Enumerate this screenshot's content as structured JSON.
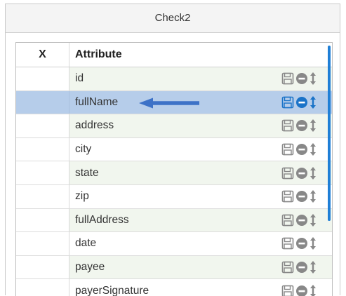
{
  "panel": {
    "title": "Check2"
  },
  "table": {
    "headers": {
      "x": "X",
      "attribute": "Attribute"
    },
    "rows": [
      {
        "label": "id",
        "selected": false
      },
      {
        "label": "fullName",
        "selected": true
      },
      {
        "label": "address",
        "selected": false
      },
      {
        "label": "city",
        "selected": false
      },
      {
        "label": "state",
        "selected": false
      },
      {
        "label": "zip",
        "selected": false
      },
      {
        "label": "fullAddress",
        "selected": false
      },
      {
        "label": "date",
        "selected": false
      },
      {
        "label": "payee",
        "selected": false
      },
      {
        "label": "payerSignature",
        "selected": false
      }
    ]
  },
  "colors": {
    "icon_default": "#888888",
    "icon_selected": "#1a73c8",
    "selected_row": "#b6cdea",
    "alt_row": "#f1f6ee",
    "arrow": "#3d72c7",
    "scrollbar": "#1f7fd6"
  },
  "icons": {
    "save": "save-icon",
    "remove": "minus-circle-icon",
    "move": "vertical-move-icon",
    "pointer": "left-arrow-icon"
  }
}
